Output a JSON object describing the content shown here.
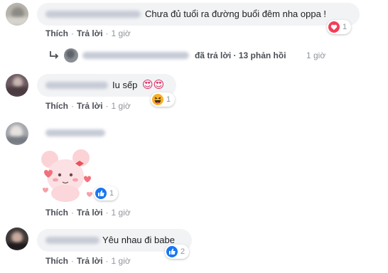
{
  "comments": [
    {
      "text": "Chưa đủ tuổi ra đường buổi đêm nha oppa !",
      "actions": {
        "like": "Thích",
        "reply": "Trả lời",
        "time": "1 giờ"
      },
      "reaction": {
        "icons": [
          "heart-icon"
        ],
        "count": "1"
      },
      "replies": {
        "summary": "đã trả lời · 13 phản hồi",
        "time": "1 giờ"
      }
    },
    {
      "text": "Iu sếp",
      "emoji": "😍😍",
      "actions": {
        "like": "Thích",
        "reply": "Trả lời",
        "time": "1 giờ"
      },
      "reaction": {
        "icons": [
          "haha-icon"
        ],
        "count": "1"
      }
    },
    {
      "sticker": "pink-bunny-sticker",
      "actions": {
        "like": "Thích",
        "reply": "Trả lời",
        "time": "1 giờ"
      },
      "reaction": {
        "icons": [
          "like-icon"
        ],
        "count": "1"
      }
    },
    {
      "text": "Yêu nhau đi babe",
      "actions": {
        "like": "Thích",
        "reply": "Trả lời",
        "time": "1 giờ"
      },
      "reaction": {
        "icons": [
          "like-icon"
        ],
        "count": "2"
      }
    }
  ],
  "colors": {
    "bubble": "#f2f3f5",
    "action_text": "#4b4f56",
    "muted_text": "#90949c",
    "like_blue": "#1877f2",
    "heart_red": "#f33e58"
  }
}
